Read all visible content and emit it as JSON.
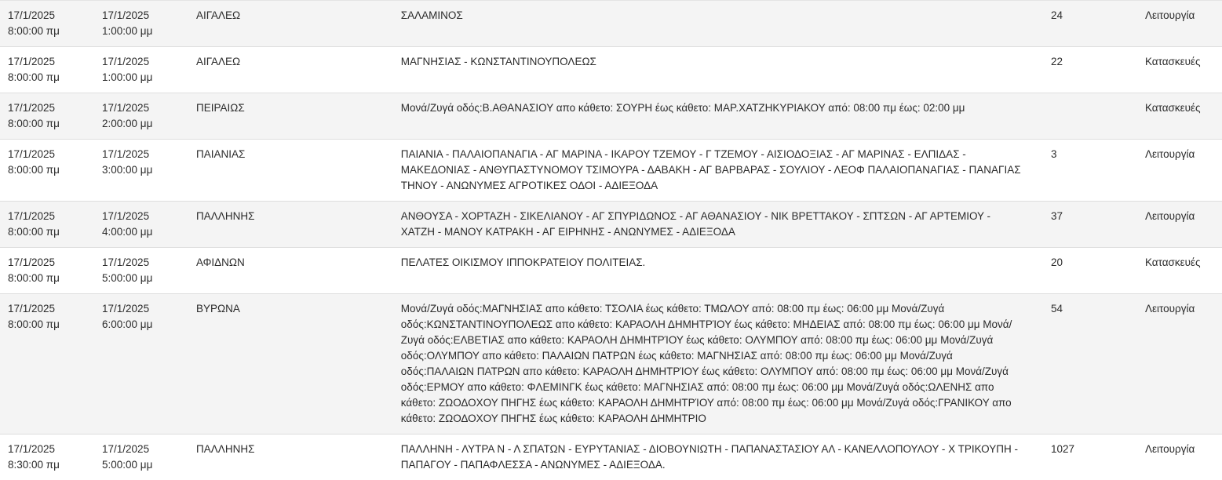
{
  "rows": [
    {
      "start_date": "17/1/2025",
      "start_time": "8:00:00 πμ",
      "end_date": "17/1/2025",
      "end_time": "1:00:00 μμ",
      "area": "ΑΙΓΑΛΕΩ",
      "streets": "ΣΑΛΑΜΙΝΟΣ",
      "count": "24",
      "type": "Λειτουργία"
    },
    {
      "start_date": "17/1/2025",
      "start_time": "8:00:00 πμ",
      "end_date": "17/1/2025",
      "end_time": "1:00:00 μμ",
      "area": "ΑΙΓΑΛΕΩ",
      "streets": "ΜΑΓΝΗΣΙΑΣ - ΚΩΝΣΤΑΝΤΙΝΟΥΠΟΛΕΩΣ",
      "count": "22",
      "type": "Κατασκευές"
    },
    {
      "start_date": "17/1/2025",
      "start_time": "8:00:00 πμ",
      "end_date": "17/1/2025",
      "end_time": "2:00:00 μμ",
      "area": "ΠΕΙΡΑΙΩΣ",
      "streets": "Μονά/Ζυγά οδός:Β.ΑΘΑΝΑΣΙΟΥ απο κάθετο: ΣΟΥΡΗ έως κάθετο: ΜΑΡ.ΧΑΤΖΗΚΥΡΙΑΚΟΥ από: 08:00 πμ έως: 02:00 μμ",
      "count": "",
      "type": "Κατασκευές"
    },
    {
      "start_date": "17/1/2025",
      "start_time": "8:00:00 πμ",
      "end_date": "17/1/2025",
      "end_time": "3:00:00 μμ",
      "area": "ΠΑΙΑΝΙΑΣ",
      "streets": "ΠΑΙΑΝΙΑ - ΠΑΛΑΙΟΠΑΝΑΓΙΑ - ΑΓ ΜΑΡΙΝΑ - ΙΚΑΡΟΥ ΤΖΕΜΟΥ - Γ ΤΖΕΜΟΥ - ΑΙΣΙΟΔΟΞΙΑΣ - ΑΓ ΜΑΡΙΝΑΣ - ΕΛΠΙΔΑΣ - ΜΑΚΕΔΟΝΙΑΣ - ΑΝΘΥΠΑΣΤΥΝΟΜΟΥ ΤΣΙΜΟΥΡΑ - ΔΑΒΑΚΗ - ΑΓ ΒΑΡΒΑΡΑΣ - ΣΟΥΛΙΟΥ - ΛΕΟΦ ΠΑΛΑΙΟΠΑΝΑΓΙΑΣ - ΠΑΝΑΓΙΑΣ ΤΗΝΟΥ - ΑΝΩΝΥΜΕΣ ΑΓΡΟΤΙΚΕΣ ΟΔΟΙ - ΑΔΙΕΞΟΔΑ",
      "count": "3",
      "type": "Λειτουργία"
    },
    {
      "start_date": "17/1/2025",
      "start_time": "8:00:00 πμ",
      "end_date": "17/1/2025",
      "end_time": "4:00:00 μμ",
      "area": "ΠΑΛΛΗΝΗΣ",
      "streets": "ΑΝΘΟΥΣΑ - ΧΟΡΤΑΖΗ - ΣΙΚΕΛΙΑΝΟΥ - ΑΓ ΣΠΥΡΙΔΩΝΟΣ - ΑΓ ΑΘΑΝΑΣΙΟΥ - ΝΙΚ ΒΡΕΤΤΑΚΟΥ - ΣΠΤΣΩΝ - ΑΓ ΑΡΤΕΜΙΟΥ - ΧΑΤΖΗ - ΜΑΝΟΥ ΚΑΤΡΑΚΗ - ΑΓ ΕΙΡΗΝΗΣ - ΑΝΩΝΥΜΕΣ - ΑΔΙΕΞΟΔΑ",
      "count": "37",
      "type": "Λειτουργία"
    },
    {
      "start_date": "17/1/2025",
      "start_time": "8:00:00 πμ",
      "end_date": "17/1/2025",
      "end_time": "5:00:00 μμ",
      "area": "ΑΦΙΔΝΩΝ",
      "streets": "ΠΕΛΑΤΕΣ ΟΙΚΙΣΜΟΥ ΙΠΠΟΚΡΑΤΕΙΟΥ ΠΟΛΙΤΕΙΑΣ.",
      "count": "20",
      "type": "Κατασκευές"
    },
    {
      "start_date": "17/1/2025",
      "start_time": "8:00:00 πμ",
      "end_date": "17/1/2025",
      "end_time": "6:00:00 μμ",
      "area": "ΒΥΡΩΝΑ",
      "streets": "Μονά/Ζυγά οδός:ΜΑΓΝΗΣΙΑΣ απο κάθετο: ΤΣΟΛΙΑ έως κάθετο: ΤΜΩΛΟΥ από: 08:00 πμ έως: 06:00 μμ Μονά/Ζυγά οδός:ΚΩΝΣΤΑΝΤΙΝΟΥΠΟΛΕΩΣ απο κάθετο: ΚΑΡΑΟΛΗ ΔΗΜΗΤΡΊΟΥ έως κάθετο: ΜΗΔΕΙΑΣ από: 08:00 πμ έως: 06:00 μμ Μονά/Ζυγά οδός:ΕΛΒΕΤΙΑΣ απο κάθετο: ΚΑΡΑΟΛΗ ΔΗΜΗΤΡΊΟΥ έως κάθετο: ΟΛΥΜΠΟΥ από: 08:00 πμ έως: 06:00 μμ Μονά/Ζυγά οδός:ΟΛΥΜΠΟΥ απο κάθετο: ΠΑΛΑΙΩΝ ΠΑΤΡΩΝ έως κάθετο: ΜΑΓΝΗΣΙΑΣ από: 08:00 πμ έως: 06:00 μμ Μονά/Ζυγά οδός:ΠΑΛΑΙΩΝ ΠΑΤΡΩΝ απο κάθετο: ΚΑΡΑΟΛΗ ΔΗΜΗΤΡΊΟΥ έως κάθετο: ΟΛΥΜΠΟΥ από: 08:00 πμ έως: 06:00 μμ Μονά/Ζυγά οδός:ΕΡΜΟΥ απο κάθετο: ΦΛΕΜΙΝΓΚ έως κάθετο: ΜΑΓΝΗΣΙΑΣ από: 08:00 πμ έως: 06:00 μμ Μονά/Ζυγά οδός:ΩΛΕΝΗΣ απο κάθετο: ΖΩΟΔΟΧΟΥ ΠΗΓΗΣ έως κάθετο: ΚΑΡΑΟΛΗ ΔΗΜΗΤΡΊΟΥ από: 08:00 πμ έως: 06:00 μμ Μονά/Ζυγά οδός:ΓΡΑΝΙΚΟΥ απο κάθετο: ΖΩΟΔΟΧΟΥ ΠΗΓΗΣ έως κάθετο: ΚΑΡΑΟΛΗ ΔΗΜΗΤΡΙΟ",
      "count": "54",
      "type": "Λειτουργία"
    },
    {
      "start_date": "17/1/2025",
      "start_time": "8:30:00 πμ",
      "end_date": "17/1/2025",
      "end_time": "5:00:00 μμ",
      "area": "ΠΑΛΛΗΝΗΣ",
      "streets": "ΠΑΛΛΗΝΗ - ΛΥΤΡΑ Ν - Λ ΣΠΑΤΩΝ - ΕΥΡΥΤΑΝΙΑΣ - ΔΙΟΒΟΥΝΙΩΤΗ - ΠΑΠΑΝΑΣΤΑΣΙΟΥ ΑΛ - ΚΑΝΕΛΛΟΠΟΥΛΟΥ - Χ ΤΡΙΚΟΥΠΗ - ΠΑΠΑΓΟΥ - ΠΑΠΑΦΛΕΣΣΑ - ΑΝΩΝΥΜΕΣ - ΑΔΙΕΞΟΔΑ.",
      "count": "1027",
      "type": "Λειτουργία"
    }
  ]
}
